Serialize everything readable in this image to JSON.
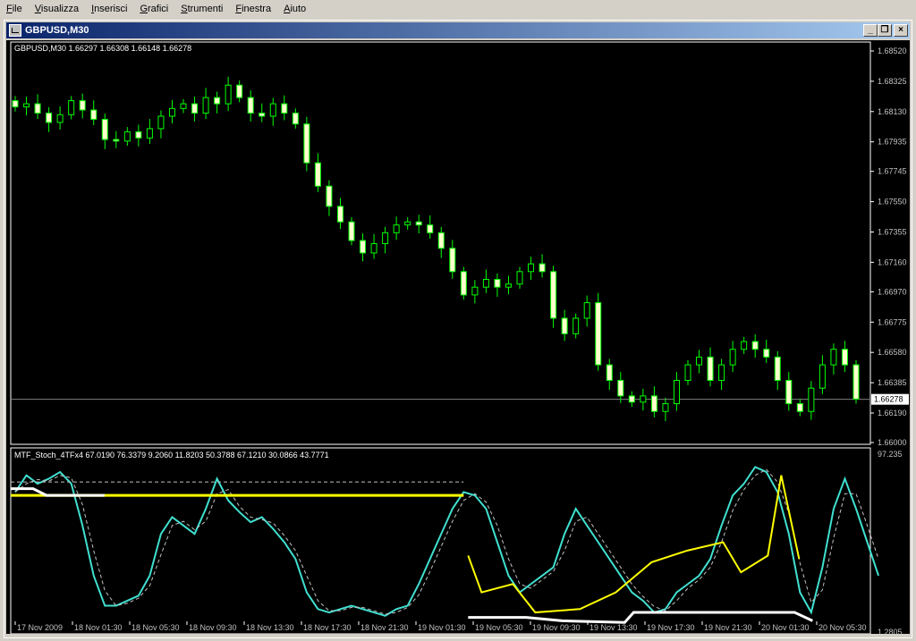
{
  "menubar": {
    "items": [
      "File",
      "Visualizza",
      "Inserisci",
      "Grafici",
      "Strumenti",
      "Finestra",
      "Aiuto"
    ]
  },
  "window": {
    "title": "GBPUSD,M30",
    "icon": "chart-window-icon",
    "buttons": {
      "minimize": "_",
      "restore": "❐",
      "close": "×"
    }
  },
  "main_chart": {
    "header": "GBPUSD,M30  1.66297 1.66308 1.66148 1.66278",
    "price_ticks": [
      "1.68520",
      "1.68325",
      "1.68130",
      "1.67935",
      "1.67745",
      "1.67550",
      "1.67355",
      "1.67160",
      "1.66970",
      "1.66775",
      "1.66580",
      "1.66385",
      "1.66190",
      "1.66000"
    ],
    "current_price": "1.66278",
    "colors": {
      "bg": "#000000",
      "bull": "#000000",
      "bear": "#ffffcc",
      "wick": "#00ff00",
      "axis": "#ffffff",
      "price_line": "#808080"
    }
  },
  "indicator": {
    "header": "MTF_Stoch_4TFx4 67.0190 76.3379 9.2060 11.8203 50.3788 67.1210 30.0866 43.7771",
    "top_label": "97.235",
    "bottom_label": "1.2805",
    "colors": {
      "turquoise": "#40e0d0",
      "yellow": "#ffff00",
      "white": "#ffffff",
      "dash": "#c0c0c0",
      "green": "#00a000"
    }
  },
  "time_axis": [
    "17 Nov 2009",
    "18 Nov 01:30",
    "18 Nov 05:30",
    "18 Nov 09:30",
    "18 Nov 13:30",
    "18 Nov 17:30",
    "18 Nov 21:30",
    "19 Nov 01:30",
    "19 Nov 05:30",
    "19 Nov 09:30",
    "19 Nov 13:30",
    "19 Nov 17:30",
    "19 Nov 21:30",
    "20 Nov 01:30",
    "20 Nov 05:30"
  ],
  "chart_data": {
    "type": "candlestick",
    "symbol": "GBPUSD",
    "timeframe": "M30",
    "ylim": [
      1.66,
      1.6852
    ],
    "candles_approx_close": [
      1.6816,
      1.6818,
      1.6812,
      1.6806,
      1.6811,
      1.682,
      1.6814,
      1.6808,
      1.6795,
      1.6794,
      1.68,
      1.6796,
      1.6802,
      1.681,
      1.6815,
      1.6818,
      1.6812,
      1.6822,
      1.6818,
      1.683,
      1.6822,
      1.6812,
      1.681,
      1.6818,
      1.6812,
      1.6805,
      1.678,
      1.6765,
      1.6752,
      1.6742,
      1.673,
      1.6722,
      1.6728,
      1.6735,
      1.674,
      1.6742,
      1.674,
      1.6735,
      1.6725,
      1.671,
      1.6695,
      1.67,
      1.6705,
      1.67,
      1.6702,
      1.671,
      1.6715,
      1.671,
      1.668,
      1.667,
      1.668,
      1.669,
      1.665,
      1.664,
      1.663,
      1.6626,
      1.663,
      1.662,
      1.6625,
      1.664,
      1.665,
      1.6655,
      1.664,
      1.665,
      1.666,
      1.6665,
      1.666,
      1.6655,
      1.664,
      1.6625,
      1.662,
      1.6635,
      1.665,
      1.666,
      1.665,
      1.6628
    ],
    "indicator_series": [
      {
        "name": "turquoise"
      },
      {
        "name": "yellow"
      },
      {
        "name": "white"
      },
      {
        "name": "dash"
      }
    ]
  }
}
